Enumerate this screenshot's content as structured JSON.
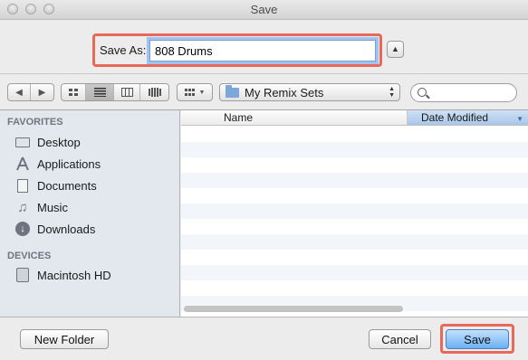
{
  "window": {
    "title": "Save"
  },
  "save_as": {
    "label": "Save As:",
    "value": "808 Drums"
  },
  "toolbar": {
    "back_icon": "chevron-left-icon",
    "forward_icon": "chevron-right-icon",
    "view_modes": [
      "icon-view",
      "list-view",
      "column-view",
      "coverflow-view"
    ],
    "active_view": "list-view",
    "arrange_icon": "arrange-grid-icon",
    "location": "My Remix Sets",
    "search_placeholder": ""
  },
  "sidebar": {
    "favorites_header": "FAVORITES",
    "favorites": [
      {
        "label": "Desktop",
        "icon": "desktop-icon"
      },
      {
        "label": "Applications",
        "icon": "applications-icon"
      },
      {
        "label": "Documents",
        "icon": "documents-icon"
      },
      {
        "label": "Music",
        "icon": "music-icon"
      },
      {
        "label": "Downloads",
        "icon": "downloads-icon"
      }
    ],
    "devices_header": "DEVICES",
    "devices": [
      {
        "label": "Macintosh HD",
        "icon": "hard-drive-icon"
      }
    ]
  },
  "file_list": {
    "columns": [
      "Name",
      "Date Modified"
    ],
    "sorted_by": "Date Modified",
    "rows": []
  },
  "buttons": {
    "new_folder": "New Folder",
    "cancel": "Cancel",
    "save": "Save"
  },
  "colors": {
    "highlight": "#e8685a",
    "default_button": "#6bb0f4",
    "sidebar_bg": "#e3e8ef",
    "sorted_column": "#a9c6e8"
  }
}
